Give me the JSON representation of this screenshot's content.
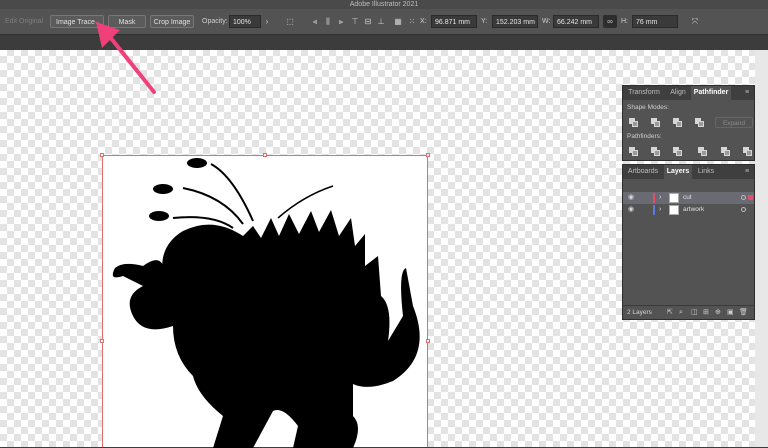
{
  "app": {
    "title": "Adobe Illustrator 2021"
  },
  "controlbar": {
    "edit_original": "Edit Original",
    "image_trace": "Image Trace",
    "mask": "Mask",
    "crop_image": "Crop Image",
    "opacity_label": "Opacity:",
    "opacity_value": "100%",
    "x_label": "X:",
    "x_value": "96.871 mm",
    "y_label": "Y:",
    "y_value": "152.203 mm",
    "w_label": "W:",
    "w_value": "66.242 mm",
    "h_label": "H:",
    "h_value": "76 mm"
  },
  "panels": {
    "top_tabs": [
      "Transform",
      "Align",
      "Pathfinder"
    ],
    "shape_modes_label": "Shape Modes:",
    "expand_label": "Expand",
    "pathfinders_label": "Pathfinders:",
    "layer_tabs": [
      "Artboards",
      "Layers",
      "Links"
    ],
    "layers": [
      {
        "name": "cut",
        "color": "#e0506a"
      },
      {
        "name": "artwork",
        "color": "#5a7ae0"
      }
    ],
    "layer_count": "2 Layers"
  },
  "colors": {
    "accent_arrow": "#f0407a",
    "selection": "#e07070"
  }
}
